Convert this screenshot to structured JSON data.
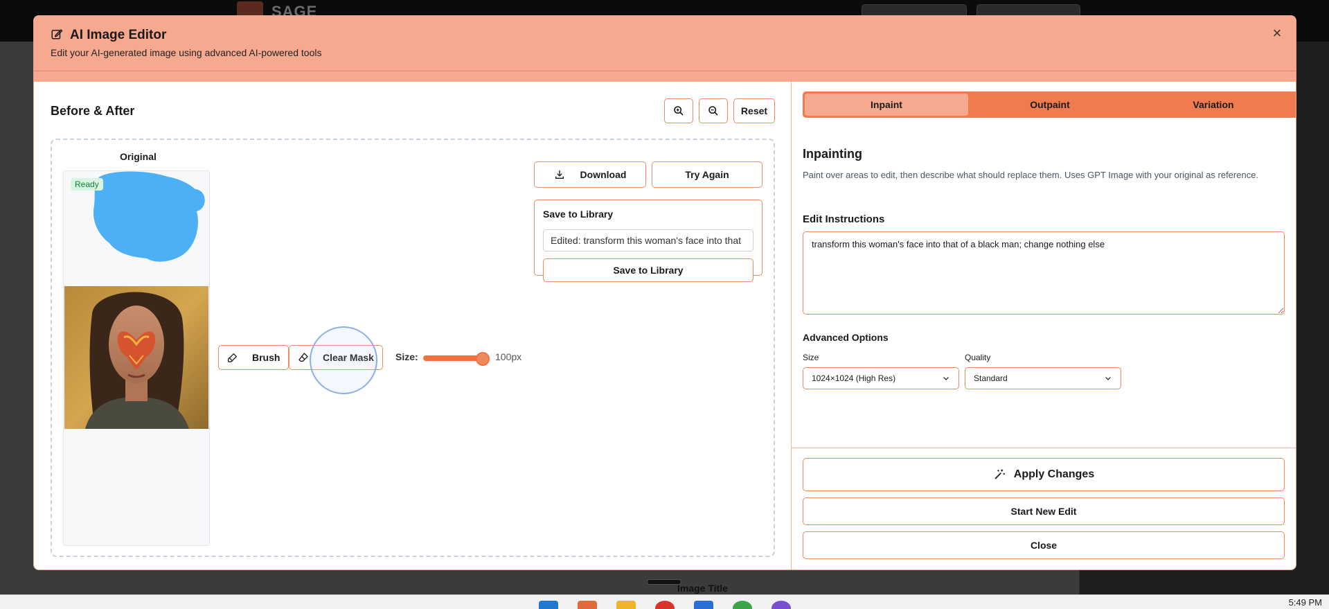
{
  "app": {
    "brand": "SAGE"
  },
  "background": {
    "image_title": "Image Title"
  },
  "taskbar": {
    "time": "5:49 PM"
  },
  "modal": {
    "title": "AI Image Editor",
    "subtitle": "Edit your AI-generated image using advanced AI-powered tools",
    "close_icon": "×"
  },
  "left": {
    "title": "Before & After",
    "zoom_in_icon": "zoom-in-icon",
    "zoom_out_icon": "zoom-out-icon",
    "reset_label": "Reset",
    "original_label": "Original",
    "status_badge": "Ready",
    "brush_label": "Brush",
    "clear_mask_label": "Clear Mask",
    "size_label": "Size:",
    "size_value": "100px",
    "brush_size_px": 100,
    "brush_size_fraction": 0.9,
    "download_label": "Download",
    "try_again_label": "Try Again",
    "library": {
      "title": "Save to Library",
      "input_value": "Edited: transform this woman's face into that",
      "save_label": "Save to Library"
    }
  },
  "right": {
    "tabs": [
      {
        "label": "Inpaint",
        "active": true
      },
      {
        "label": "Outpaint",
        "active": false
      },
      {
        "label": "Variation",
        "active": false
      }
    ],
    "section_title": "Inpainting",
    "section_desc": "Paint over areas to edit, then describe what should replace them. Uses GPT Image with your original as reference.",
    "edit_label": "Edit Instructions",
    "edit_value": "transform this woman's face into that of a black man; change nothing else",
    "advanced_label": "Advanced Options",
    "size_field_label": "Size",
    "size_selected": "1024×1024 (High Res)",
    "quality_field_label": "Quality",
    "quality_selected": "Standard",
    "apply_label": "Apply Changes",
    "start_new_label": "Start New Edit",
    "close_label": "Close"
  },
  "colors": {
    "header": "#f6a98e",
    "accent": "#f08a5d",
    "tab_bar": "#ef7b4e",
    "mask": "#4db0f5"
  }
}
